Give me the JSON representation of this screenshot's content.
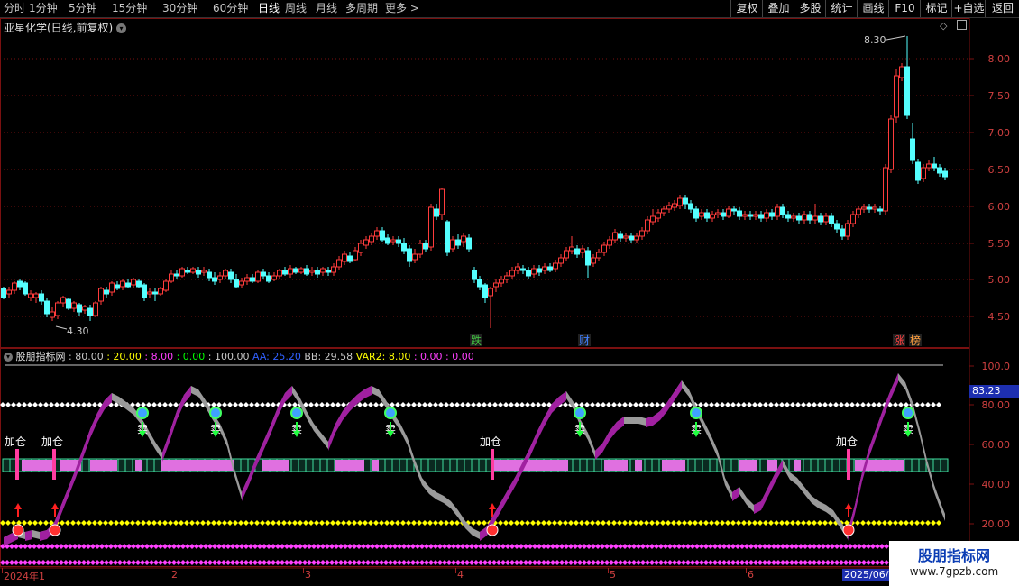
{
  "toolbar": {
    "tabs": [
      "分时",
      "1分钟",
      "5分钟",
      "15分钟",
      "30分钟",
      "60分钟",
      "日线",
      "周线",
      "月线",
      "多周期",
      "更多 >"
    ],
    "active_tab": "日线",
    "right_buttons": [
      "复权",
      "叠加",
      "多股",
      "统计",
      "画线",
      "F10",
      "标记",
      "+自选",
      "返回"
    ]
  },
  "main": {
    "title": "亚星化学(日线,前复权)",
    "y_ticks": [
      "8.00",
      "7.50",
      "7.00",
      "6.50",
      "6.00",
      "5.50",
      "5.00",
      "4.50"
    ],
    "high_label": "8.30",
    "low_label": "4.30",
    "event_markers": [
      {
        "text": "跌",
        "color": "#40c040"
      },
      {
        "text": "财",
        "color": "#4080ff"
      },
      {
        "text": "涨",
        "color": "#ff4040"
      },
      {
        "text": "榜",
        "color": "#ffa040"
      }
    ],
    "colors": {
      "up": "#ff3c3c",
      "down": "#54ffff",
      "grid": "#7a1010"
    }
  },
  "indicator": {
    "name": "股朋指标网",
    "values": [
      {
        "text": ": 80.00",
        "color": "#c8c8c8"
      },
      {
        "text": ": 20.00",
        "color": "#ffff00"
      },
      {
        "text": ": 8.00",
        "color": "#ff40ff"
      },
      {
        "text": ": 0.00",
        "color": "#00ff00"
      },
      {
        "text": ": 100.00",
        "color": "#c8c8c8"
      },
      {
        "text": "AA: 25.20",
        "color": "#3060ff"
      },
      {
        "text": "BB: 29.58",
        "color": "#c8c8c8"
      },
      {
        "text": "VAR2: 8.00",
        "color": "#ffff00"
      },
      {
        "text": ": 0.00",
        "color": "#ff40ff"
      },
      {
        "text": ": 0.00",
        "color": "#ff40ff"
      }
    ],
    "y_ticks": [
      "100.0",
      "80.00",
      "60.00",
      "40.00",
      "20.00"
    ],
    "current_value": "83.23",
    "add_label": "加仓",
    "sell_label": "卖"
  },
  "date_axis": {
    "labels": [
      "2024年1",
      "2",
      "3",
      "4",
      "5",
      "6"
    ],
    "cursor_date": "2025/06/"
  },
  "watermark": {
    "title": "股朋指标网",
    "url": "www.7gpzb.com"
  }
}
